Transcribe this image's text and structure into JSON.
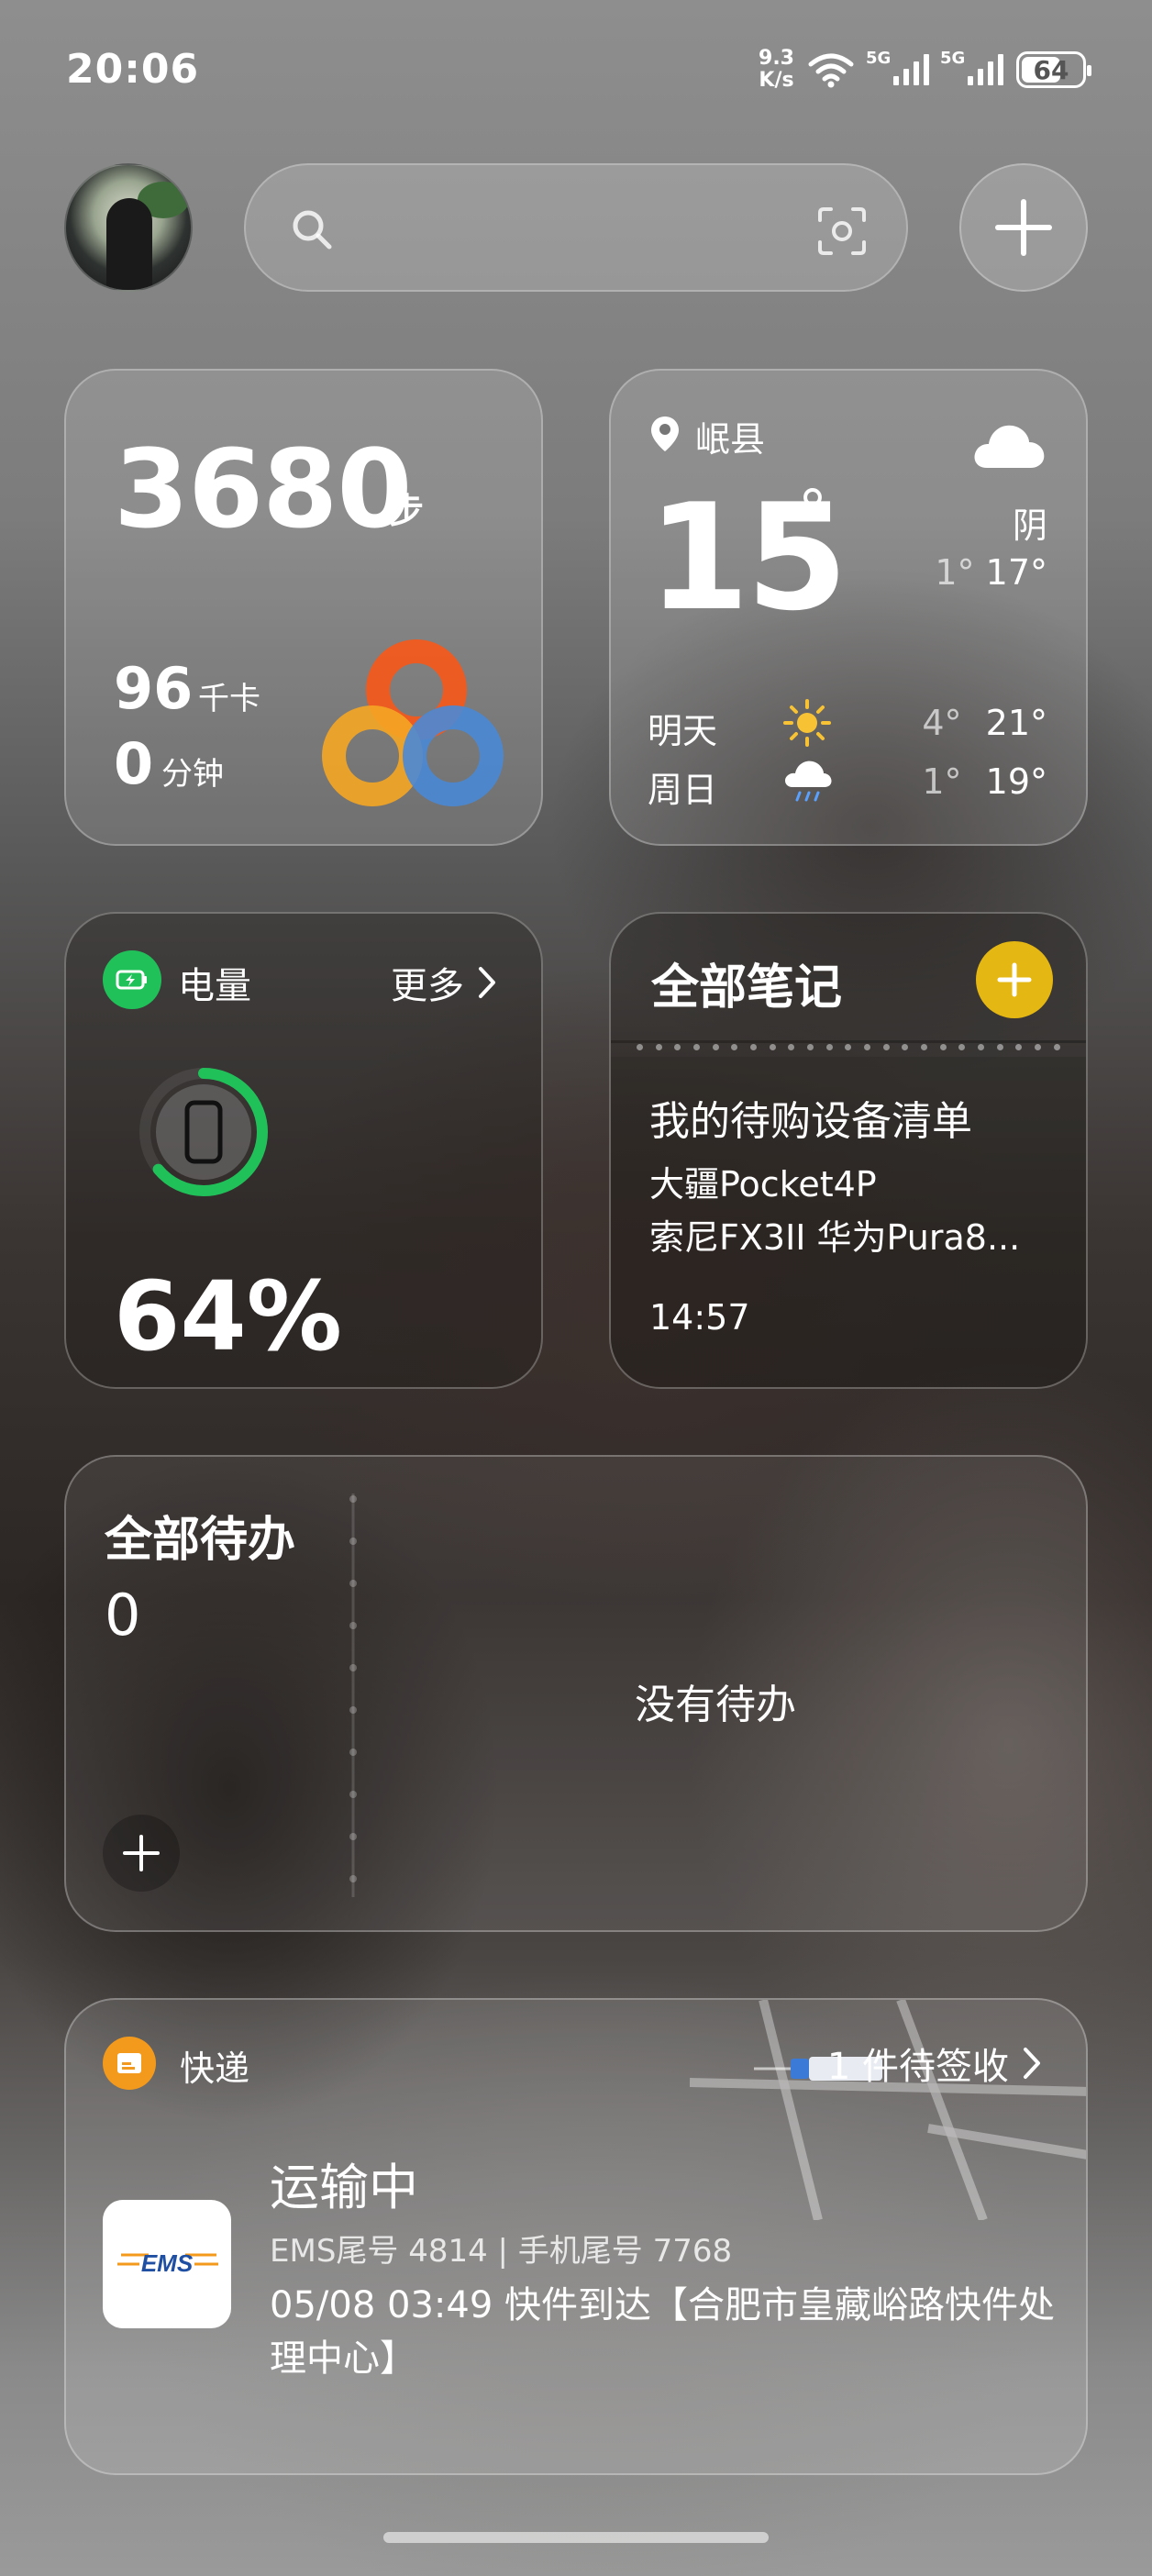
{
  "status_bar": {
    "time": "20:06",
    "net_speed_value": "9.3",
    "net_speed_unit": "K/s",
    "signal1_label": "5G",
    "signal2_label": "5G",
    "battery": "64"
  },
  "search": {
    "placeholder": ""
  },
  "steps": {
    "count": "3680",
    "unit": "步",
    "calories": "96",
    "calories_unit": "千卡",
    "minutes": "0",
    "minutes_unit": "分钟"
  },
  "weather": {
    "location": "岷县",
    "temp": "15",
    "degree_symbol": "°",
    "condition": "阴",
    "low": "1°",
    "high": "17°",
    "forecast": [
      {
        "day": "明天",
        "icon": "sunny-icon",
        "low": "4°",
        "high": "21°"
      },
      {
        "day": "周日",
        "icon": "rain-cloud-icon",
        "low": "1°",
        "high": "19°"
      }
    ]
  },
  "battery_card": {
    "title": "电量",
    "more": "更多",
    "percent": "64%",
    "level": 0.64,
    "ring_color": "#21c15a"
  },
  "notes": {
    "title": "全部笔记",
    "note_title": "我的待购设备清单",
    "line1": "大疆Pocket4P",
    "line2": "索尼FX3II 华为Pura8...",
    "time": "14:57",
    "accent": "#e5b713"
  },
  "todo": {
    "title": "全部待办",
    "count": "0",
    "empty_text": "没有待办"
  },
  "express": {
    "title": "快递",
    "pending": "1 件待签收",
    "carrier_logo": "EMS",
    "status": "运输中",
    "tracking": "EMS尾号 4814 | 手机尾号 7768",
    "detail": "05/08 03:49 快件到达【合肥市皇藏峪路快件处理中心】",
    "accent": "#f39a1c"
  }
}
